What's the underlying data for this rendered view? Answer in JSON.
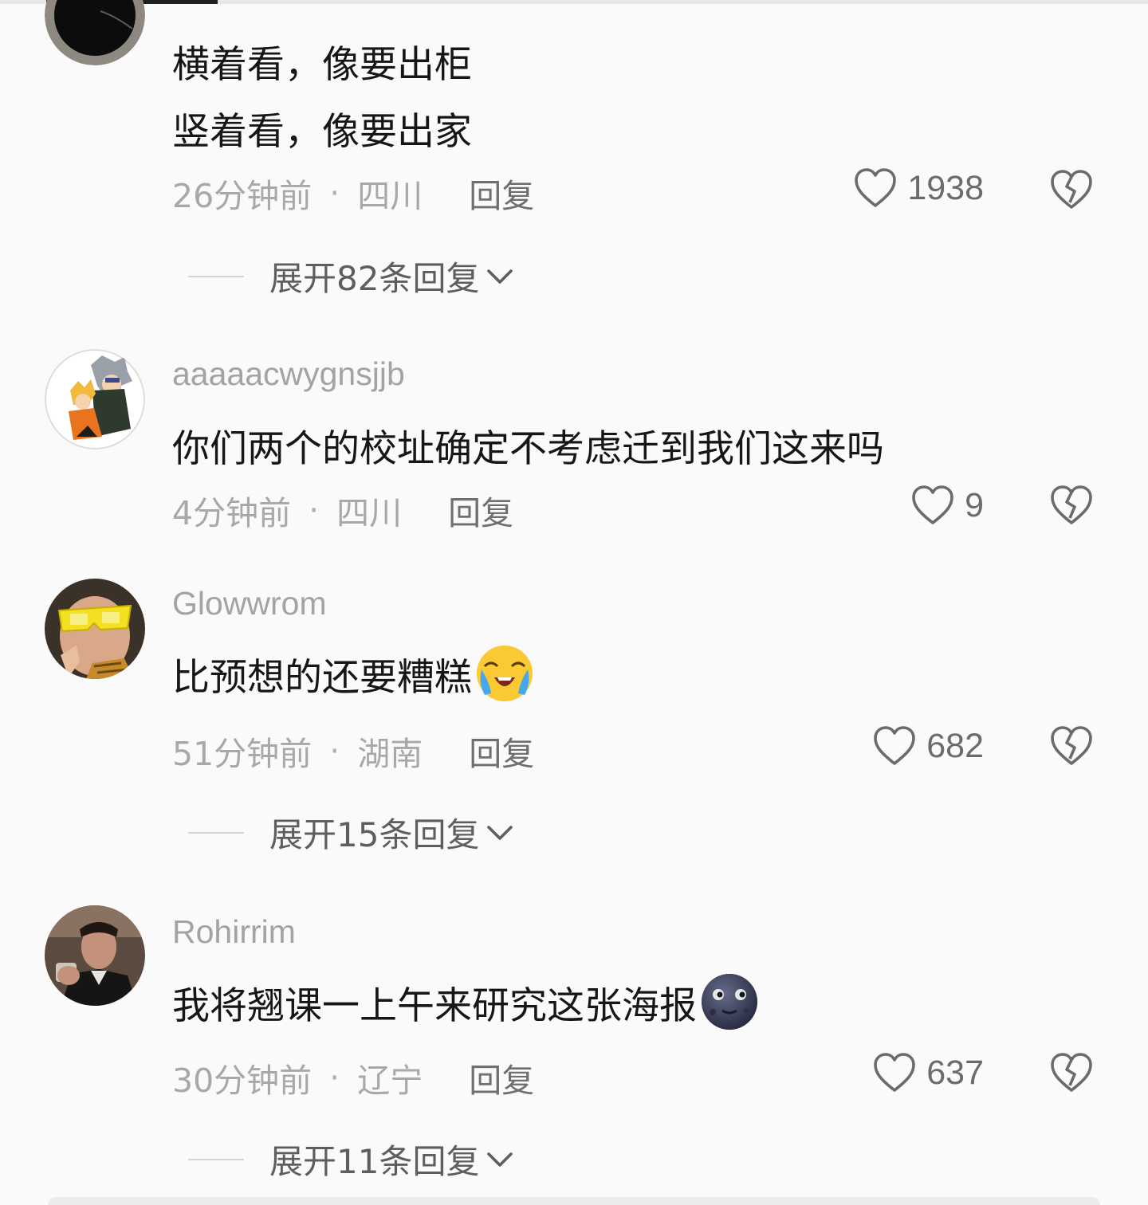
{
  "comments": [
    {
      "username": "",
      "lines": [
        "横着看，像要出柜",
        "竖着看，像要出家"
      ],
      "time": "26分钟前",
      "location": "四川",
      "reply_label": "回复",
      "likes": "1938",
      "expand_label": "展开82条回复"
    },
    {
      "username": "aaaaacwygnsjjb",
      "lines": [
        "你们两个的校址确定不考虑迁到我们这来吗"
      ],
      "time": "4分钟前",
      "location": "四川",
      "reply_label": "回复",
      "likes": "9"
    },
    {
      "username": "Glowwrom",
      "lines": [
        "比预想的还要糟糕"
      ],
      "emoji": "loudly-crying-face",
      "time": "51分钟前",
      "location": "湖南",
      "reply_label": "回复",
      "likes": "682",
      "expand_label": "展开15条回复"
    },
    {
      "username": "Rohirrim",
      "lines": [
        "我将翘课一上午来研究这张海报"
      ],
      "emoji": "new-moon-face",
      "time": "30分钟前",
      "location": "辽宁",
      "reply_label": "回复",
      "likes": "637",
      "expand_label": "展开11条回复"
    }
  ],
  "separator": "·",
  "icons": {
    "like": "heart-outline-icon",
    "dislike": "broken-heart-icon",
    "expand": "chevron-down-icon"
  },
  "colors": {
    "background": "#fafafa",
    "text_primary": "#161616",
    "text_secondary": "#a8a8a8",
    "reply": "#6f6f6f"
  }
}
